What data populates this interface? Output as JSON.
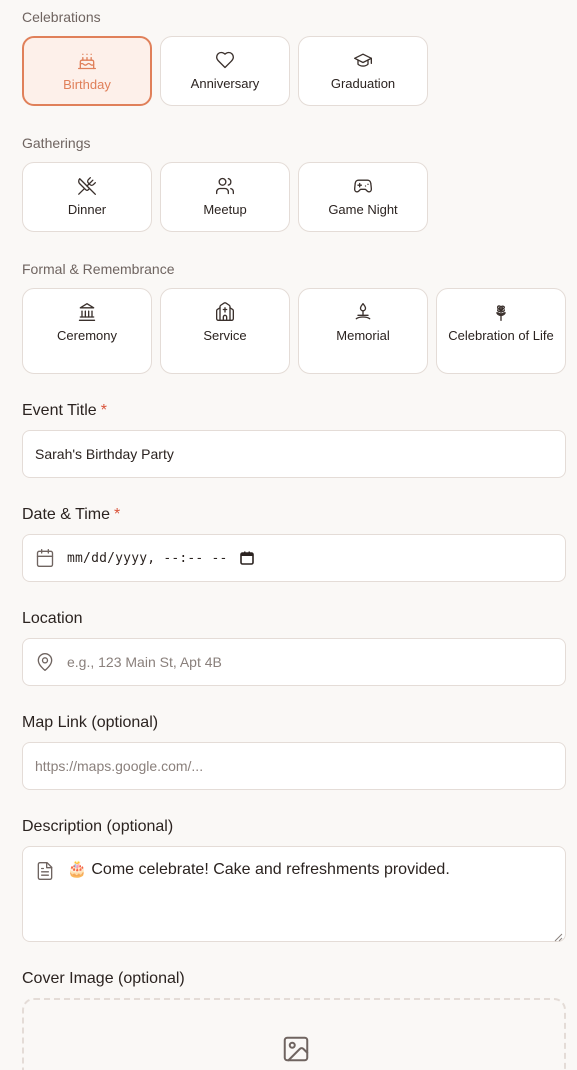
{
  "event_types": {
    "groups": [
      {
        "label": "Celebrations",
        "items": [
          {
            "label": "Birthday",
            "icon": "cake-icon",
            "selected": true
          },
          {
            "label": "Anniversary",
            "icon": "heart-icon",
            "selected": false
          },
          {
            "label": "Graduation",
            "icon": "graduation-cap-icon",
            "selected": false
          }
        ]
      },
      {
        "label": "Gatherings",
        "items": [
          {
            "label": "Dinner",
            "icon": "utensils-crossed-icon",
            "selected": false
          },
          {
            "label": "Meetup",
            "icon": "users-icon",
            "selected": false
          },
          {
            "label": "Game Night",
            "icon": "gamepad-icon",
            "selected": false
          }
        ]
      },
      {
        "label": "Formal & Remembrance",
        "items": [
          {
            "label": "Ceremony",
            "icon": "landmark-icon",
            "selected": false
          },
          {
            "label": "Service",
            "icon": "church-icon",
            "selected": false
          },
          {
            "label": "Memorial",
            "icon": "candle-flame-icon",
            "selected": false
          },
          {
            "label": "Celebration of Life",
            "icon": "flower-icon",
            "selected": false
          }
        ]
      }
    ]
  },
  "form": {
    "title": {
      "label": "Event Title",
      "required_mark": "*",
      "value": "Sarah's Birthday Party"
    },
    "datetime": {
      "label": "Date & Time",
      "required_mark": "*",
      "value": "mm/dd/yyyy, --:-- --"
    },
    "location": {
      "label": "Location",
      "placeholder": "e.g., 123 Main St, Apt 4B"
    },
    "map_link": {
      "label": "Map Link (optional)",
      "placeholder": "https://maps.google.com/..."
    },
    "description": {
      "label": "Description (optional)",
      "value": "🎂 Come celebrate! Cake and refreshments provided."
    },
    "cover_image": {
      "label": "Cover Image (optional)"
    }
  },
  "colors": {
    "accent": "#e0805a",
    "accent_bg": "#fdf0ea",
    "border": "#e4dcd7",
    "required": "#d9533a",
    "background": "#faf8f6"
  }
}
